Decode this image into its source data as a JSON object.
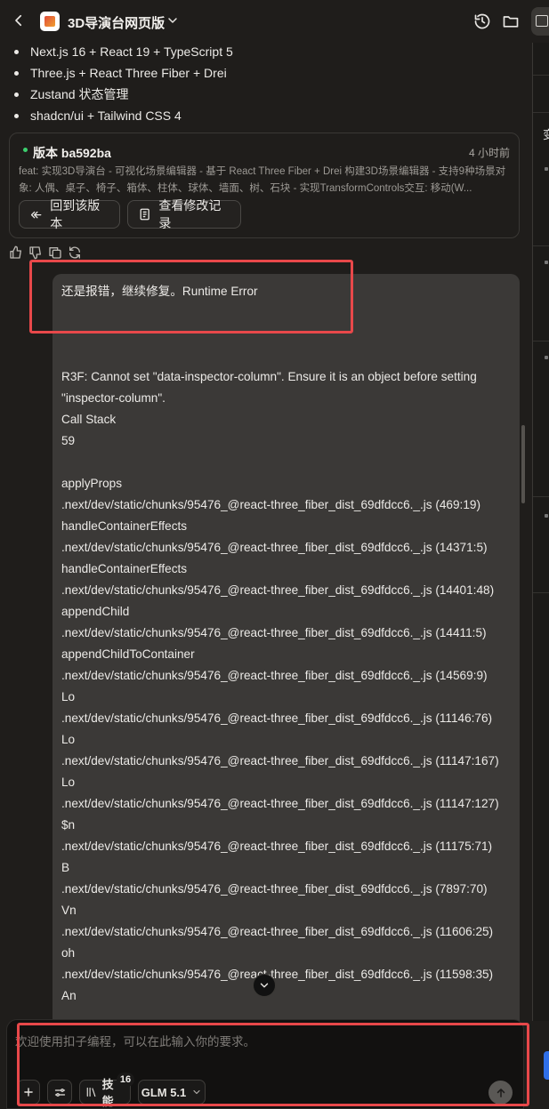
{
  "header": {
    "title": "3D导演台网页版"
  },
  "bullets": [
    "Next.js 16 + React 19 + TypeScript 5",
    "Three.js + React Three Fiber + Drei",
    "Zustand 状态管理",
    "shadcn/ui + Tailwind CSS 4"
  ],
  "version_card": {
    "title": "版本 ba592ba",
    "time": "4 小时前",
    "description": "feat: 实现3D导演台 - 可视化场景编辑器 - 基于 React Three Fiber + Drei 构建3D场景编辑器 - 支持9种场景对象: 人偶、桌子、椅子、箱体、柱体、球体、墙面、树、石块 - 实现TransformControls交互: 移动(W...",
    "rollback_label": "回到该版本",
    "changes_label": "查看修改记录"
  },
  "side_panel": {
    "peek_text": "变"
  },
  "message": {
    "text": "还是报错，继续修复。Runtime Error\n\n\n\nR3F: Cannot set \"data-inspector-column\". Ensure it is an object before setting \"inspector-column\".\nCall Stack\n59\n\napplyProps\n.next/dev/static/chunks/95476_@react-three_fiber_dist_69dfdcc6._.js (469:19)\nhandleContainerEffects\n.next/dev/static/chunks/95476_@react-three_fiber_dist_69dfdcc6._.js (14371:5)\nhandleContainerEffects\n.next/dev/static/chunks/95476_@react-three_fiber_dist_69dfdcc6._.js (14401:48)\nappendChild\n.next/dev/static/chunks/95476_@react-three_fiber_dist_69dfdcc6._.js (14411:5)\nappendChildToContainer\n.next/dev/static/chunks/95476_@react-three_fiber_dist_69dfdcc6._.js (14569:9)\nLo\n.next/dev/static/chunks/95476_@react-three_fiber_dist_69dfdcc6._.js (11146:76)\nLo\n.next/dev/static/chunks/95476_@react-three_fiber_dist_69dfdcc6._.js (11147:167)\nLo\n.next/dev/static/chunks/95476_@react-three_fiber_dist_69dfdcc6._.js (11147:127)\n$n\n.next/dev/static/chunks/95476_@react-three_fiber_dist_69dfdcc6._.js (11175:71)\nB\n.next/dev/static/chunks/95476_@react-three_fiber_dist_69dfdcc6._.js (7897:70)\nVn\n.next/dev/static/chunks/95476_@react-three_fiber_dist_69dfdcc6._.js (11606:25)\noh\n.next/dev/static/chunks/95476_@react-three_fiber_dist_69dfdcc6._.js (11598:35)\nAn"
  },
  "input": {
    "placeholder": "欢迎使用扣子编程，可以在此输入你的要求。",
    "skills_label": "技能",
    "skills_count": "16",
    "model_label": "GLM 5.1"
  },
  "colors": {
    "background": "#1f1d1b",
    "bubble": "#3b3937",
    "highlight": "#e8484a",
    "status_dot": "#3ccf6e"
  },
  "icons": [
    "back-icon",
    "app-logo",
    "chevron-down-icon",
    "history-icon",
    "folder-icon",
    "rollback-icon",
    "document-icon",
    "thumbs-up-icon",
    "thumbs-down-icon",
    "copy-icon",
    "refresh-icon",
    "arrow-down-icon",
    "plus-icon",
    "settings-sliders-icon",
    "skills-icon",
    "send-arrow-up-icon"
  ]
}
